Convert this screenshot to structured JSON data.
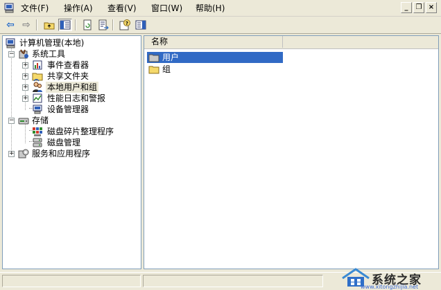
{
  "menu": {
    "items": [
      {
        "label": "文件(F)"
      },
      {
        "label": "操作(A)"
      },
      {
        "label": "查看(V)"
      },
      {
        "label": "窗口(W)"
      },
      {
        "label": "帮助(H)"
      }
    ],
    "window_buttons": {
      "minimize": "_",
      "restore": "❐",
      "close": "×"
    }
  },
  "toolbar": {
    "back_glyph": "⇦",
    "forward_glyph": "⇨",
    "icons": [
      "up-one-level-icon",
      "show-hide-tree-icon",
      "refresh-icon",
      "export-list-icon",
      "help-icon",
      "show-hide-action-pane-icon"
    ]
  },
  "tree": {
    "root": "计算机管理(本地)",
    "system_tools": "系统工具",
    "event_viewer": "事件查看器",
    "shared_folders": "共享文件夹",
    "local_users_groups": "本地用户和组",
    "perf_logs": "性能日志和警报",
    "device_manager": "设备管理器",
    "storage": "存储",
    "defrag": "磁盘碎片整理程序",
    "disk_mgmt": "磁盘管理",
    "services_apps": "服务和应用程序",
    "expand_glyph": "+",
    "collapse_glyph": "−"
  },
  "list": {
    "column_name": "名称",
    "rows": [
      {
        "label": "用户",
        "selected": true
      },
      {
        "label": "组",
        "selected": false
      }
    ]
  },
  "watermark": {
    "text": "系统之家",
    "url": "www.xitongzhijia.net"
  },
  "colors": {
    "selection": "#316ac5",
    "chrome": "#ece9d8",
    "pane_border": "#7f9db9",
    "folder": "#f5d96b"
  }
}
